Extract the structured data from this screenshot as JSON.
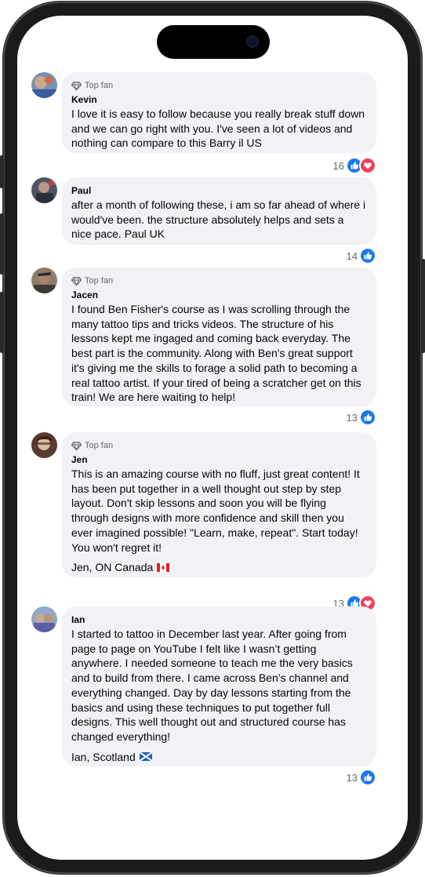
{
  "comments": [
    {
      "badge": "Top fan",
      "name": "Kevin",
      "text": "I love it is easy to follow because you really break stuff down and we can go right with you. I've seen a lot of videos and nothing can compare to this Barry il US",
      "reactions": {
        "count": "16",
        "icons": [
          "like-icon",
          "love-icon"
        ]
      }
    },
    {
      "badge": "",
      "name": "Paul",
      "text": "after a month of following these, i am so far ahead of where i would've been. the structure absolutely helps and sets a nice pace. Paul UK",
      "reactions": {
        "count": "14",
        "icons": [
          "like-icon"
        ]
      }
    },
    {
      "badge": "Top fan",
      "name": "Jacen",
      "text": "I found Ben Fisher's course as I was scrolling through the many tattoo tips and tricks videos. The structure of his lessons kept me ingaged and coming back everyday. The best part is the community. Along with Ben's great support it's giving me the skills to forage a solid path to becoming a real tattoo artist. If your tired of being a scratcher get on this train! We are here waiting to help!",
      "reactions": {
        "count": "13",
        "icons": [
          "like-icon"
        ]
      }
    },
    {
      "badge": "Top fan",
      "name": "Jen",
      "text": "This is an amazing course with no fluff, just great content! It has been put together in a well thought out step by step layout. Don't skip lessons and soon you will be flying through designs with more confidence and skill then you ever imagined possible! \"Learn, make, repeat\". Start today! You won't regret it!",
      "signature": "Jen, ON Canada",
      "flag": "canada-flag-icon",
      "reactions": {
        "count": "13",
        "icons": [
          "like-icon",
          "love-icon"
        ]
      }
    },
    {
      "badge": "",
      "name": "Ian",
      "text": "I started to tattoo in December last year. After going from page to page on YouTube I felt like I wasn’t getting anywhere. I needed someone to teach me the very basics and to build from there. I came across Ben’s channel and everything changed. Day by day lessons starting from the basics and using these techniques to put together full designs. This well thought out and structured course has changed everything!",
      "signature": "Ian, Scotland",
      "flag": "scotland-flag-icon",
      "reactions": {
        "count": "13",
        "icons": [
          "like-icon"
        ]
      }
    }
  ],
  "colors": {
    "bubble": "#f0f2f5",
    "like": "#1877f2",
    "love": "#f33e58",
    "secondary_text": "#65676b"
  }
}
